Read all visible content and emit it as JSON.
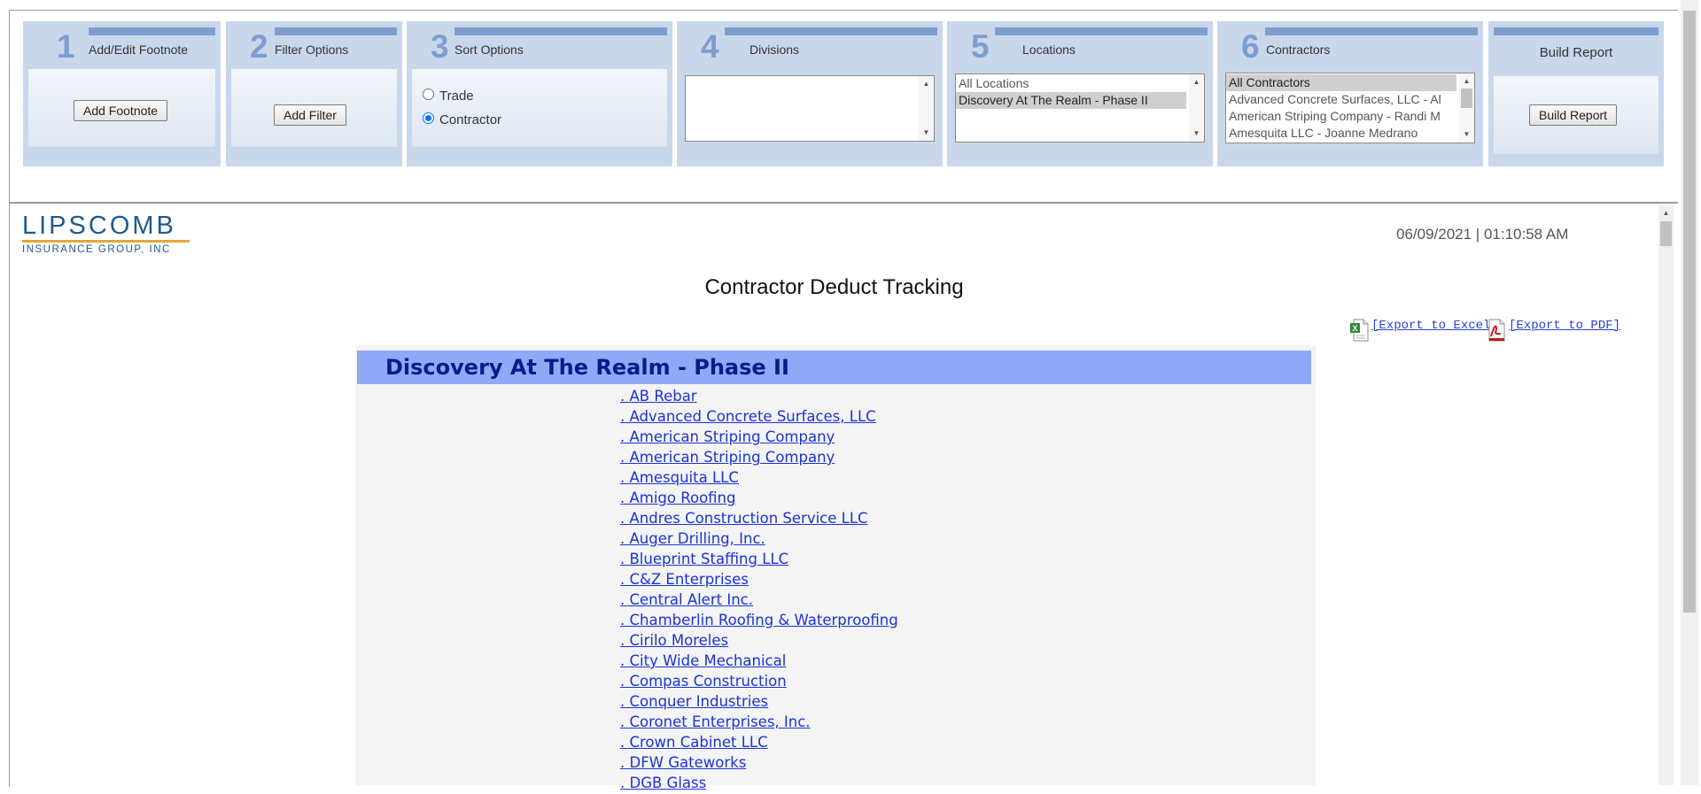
{
  "steps": [
    {
      "num": "1",
      "title": "Add/Edit Footnote",
      "button": "Add Footnote"
    },
    {
      "num": "2",
      "title": "Filter Options",
      "button": "Add Filter"
    },
    {
      "num": "3",
      "title": "Sort Options",
      "radios": [
        {
          "label": "Trade",
          "checked": false
        },
        {
          "label": "Contractor",
          "checked": true
        }
      ]
    },
    {
      "num": "4",
      "title": "Divisions",
      "options": []
    },
    {
      "num": "5",
      "title": "Locations",
      "options": [
        "All Locations",
        "Discovery At The Realm - Phase II"
      ],
      "selected": "Discovery At The Realm - Phase II"
    },
    {
      "num": "6",
      "title": "Contractors",
      "options": [
        "All Contractors",
        "Advanced Concrete Surfaces, LLC - Al",
        "American Striping Company - Randi M",
        "Amesquita LLC - Joanne Medrano"
      ],
      "selected": "All Contractors"
    }
  ],
  "build": {
    "title": "Build Report",
    "button": "Build Report"
  },
  "report": {
    "logo": {
      "main": "LIPSCOMB",
      "sub": "INSURANCE GROUP, INC"
    },
    "timestamp": "06/09/2021 | 01:10:58 AM",
    "title": "Contractor Deduct Tracking",
    "export_excel": "[Export to Excel]",
    "export_pdf": "[Export to PDF]",
    "project": "Discovery At The Realm - Phase II",
    "contractors": [
      ". AB Rebar",
      ". Advanced Concrete Surfaces, LLC",
      ". American Striping Company",
      ". American Striping Company",
      ". Amesquita LLC",
      ". Amigo Roofing",
      ". Andres Construction Service LLC",
      ". Auger Drilling, Inc.",
      ". Blueprint Staffing LLC",
      ". C&Z Enterprises",
      ". Central Alert Inc.",
      ". Chamberlin Roofing & Waterproofing",
      ". Cirilo Moreles",
      ". City Wide Mechanical",
      ". Compas Construction",
      ". Conquer Industries",
      ". Coronet Enterprises, Inc.",
      ". Crown Cabinet LLC",
      ". DFW Gateworks",
      ". DGB Glass"
    ]
  },
  "colors": {
    "panel": "#c9d7eb",
    "panel_bar": "#7f9ed0",
    "project_header": "#8eaaf7",
    "link": "#1a33d6",
    "logo_blue": "#1f5a8c",
    "logo_gold": "#e2a83a"
  }
}
